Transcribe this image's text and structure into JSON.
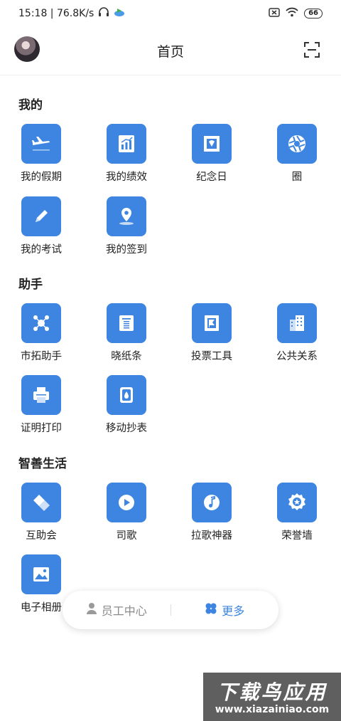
{
  "status_bar": {
    "time_speed": "15:18 | 76.8K/s",
    "battery": "66"
  },
  "header": {
    "title": "首页"
  },
  "sections": [
    {
      "title": "我的",
      "items": [
        {
          "label": "我的假期",
          "icon": "airplane-icon"
        },
        {
          "label": "我的绩效",
          "icon": "chart-icon"
        },
        {
          "label": "纪念日",
          "icon": "stamp-icon"
        },
        {
          "label": "圈",
          "icon": "aperture-icon"
        },
        {
          "label": "我的考试",
          "icon": "pencil-icon"
        },
        {
          "label": "我的签到",
          "icon": "location-pin-icon"
        }
      ]
    },
    {
      "title": "助手",
      "items": [
        {
          "label": "市拓助手",
          "icon": "network-icon"
        },
        {
          "label": "晓纸条",
          "icon": "note-icon"
        },
        {
          "label": "投票工具",
          "icon": "flag-icon"
        },
        {
          "label": "公共关系",
          "icon": "building-icon"
        },
        {
          "label": "证明打印",
          "icon": "printer-icon"
        },
        {
          "label": "移动抄表",
          "icon": "water-meter-icon"
        }
      ]
    },
    {
      "title": "智善生活",
      "items": [
        {
          "label": "互助会",
          "icon": "handshake-icon"
        },
        {
          "label": "司歌",
          "icon": "play-icon"
        },
        {
          "label": "拉歌神器",
          "icon": "music-note-icon"
        },
        {
          "label": "荣誉墙",
          "icon": "medal-icon"
        },
        {
          "label": "电子相册",
          "icon": "photo-icon"
        }
      ]
    }
  ],
  "float_bar": {
    "staff_center": "员工中心",
    "more": "更多"
  },
  "watermark": {
    "title": "下载鸟应用",
    "url": "www.xiazainiao.com"
  },
  "colors": {
    "accent": "#3d85e0",
    "text": "#222222",
    "muted": "#8a8a8a"
  }
}
